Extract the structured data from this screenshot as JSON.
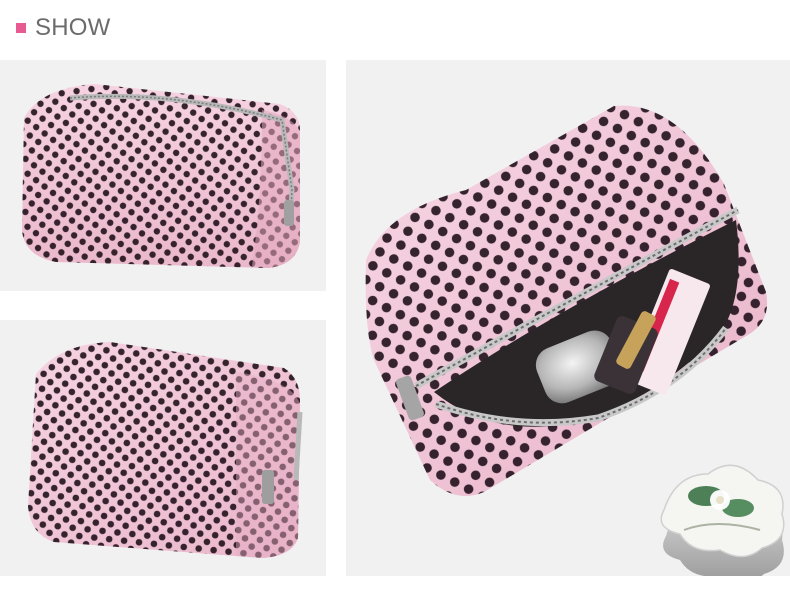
{
  "header": {
    "title": "SHOW",
    "accent_color": "#e85a92"
  },
  "colors": {
    "bag_pink": "#f2c7d8",
    "dot_color": "#2b1a25",
    "photo_background": "#f1f1f1"
  },
  "photos": [
    {
      "name": "pouch-closed-front",
      "description": ""
    },
    {
      "name": "pouch-closed-angle",
      "description": ""
    },
    {
      "name": "pouch-open-with-cosmetics",
      "description": ""
    }
  ]
}
